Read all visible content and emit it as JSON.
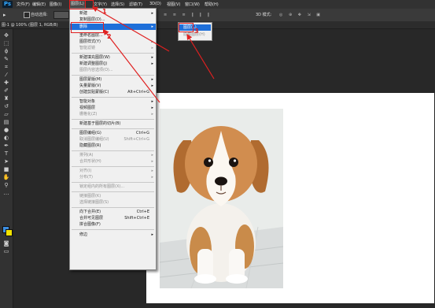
{
  "app": {
    "logo": "Ps"
  },
  "menubar": {
    "items": [
      {
        "label": "文件(F)"
      },
      {
        "label": "编辑(E)"
      },
      {
        "label": "图像(I)"
      },
      {
        "label": "图层(L)"
      },
      {
        "label": "文字(Y)"
      },
      {
        "label": "选择(S)"
      },
      {
        "label": "滤镜(T)"
      },
      {
        "label": "3D(D)"
      },
      {
        "label": "视图(V)"
      },
      {
        "label": "窗口(W)"
      },
      {
        "label": "帮助(H)"
      }
    ]
  },
  "options": {
    "auto_select": "自动选择:",
    "mode_3d": "3D 模式:"
  },
  "tab": {
    "title": "图-1 @ 100% (图层 1, RGB/8)"
  },
  "layer_menu": {
    "items": [
      {
        "label": "新建",
        "shortcut": "",
        "submenu": true,
        "disabled": false
      },
      {
        "label": "复制图层(D)...",
        "shortcut": "",
        "submenu": false,
        "disabled": false
      },
      {
        "label": "删除",
        "shortcut": "",
        "submenu": true,
        "disabled": false,
        "highlighted": true
      },
      {
        "label": "重命名图层...",
        "shortcut": "",
        "submenu": false,
        "disabled": false
      },
      {
        "label": "图层样式(Y)",
        "shortcut": "",
        "submenu": true,
        "disabled": false
      },
      {
        "label": "智能滤镜",
        "shortcut": "",
        "submenu": true,
        "disabled": true
      },
      {
        "label": "新建填充图层(W)",
        "shortcut": "",
        "submenu": true,
        "disabled": false
      },
      {
        "label": "新建调整图层(J)",
        "shortcut": "",
        "submenu": true,
        "disabled": false
      },
      {
        "label": "图层内容选项(O)...",
        "shortcut": "",
        "submenu": false,
        "disabled": true
      },
      {
        "label": "图层蒙版(M)",
        "shortcut": "",
        "submenu": true,
        "disabled": false
      },
      {
        "label": "矢量蒙版(V)",
        "shortcut": "",
        "submenu": true,
        "disabled": false
      },
      {
        "label": "创建剪贴蒙版(C)",
        "shortcut": "Alt+Ctrl+G",
        "submenu": false,
        "disabled": false
      },
      {
        "label": "智能对象",
        "shortcut": "",
        "submenu": true,
        "disabled": false
      },
      {
        "label": "视频图层",
        "shortcut": "",
        "submenu": true,
        "disabled": false
      },
      {
        "label": "栅格化(Z)",
        "shortcut": "",
        "submenu": true,
        "disabled": true
      },
      {
        "label": "新建基于图层的切片(B)",
        "shortcut": "",
        "submenu": false,
        "disabled": false
      },
      {
        "label": "图层编组(G)",
        "shortcut": "Ctrl+G",
        "submenu": false,
        "disabled": false
      },
      {
        "label": "取消图层编组(U)",
        "shortcut": "Shift+Ctrl+G",
        "submenu": false,
        "disabled": true
      },
      {
        "label": "隐藏图层(R)",
        "shortcut": "",
        "submenu": false,
        "disabled": false
      },
      {
        "label": "排列(A)",
        "shortcut": "",
        "submenu": true,
        "disabled": true
      },
      {
        "label": "合并形状(H)",
        "shortcut": "",
        "submenu": true,
        "disabled": true
      },
      {
        "label": "对齐(I)",
        "shortcut": "",
        "submenu": true,
        "disabled": true
      },
      {
        "label": "分布(T)",
        "shortcut": "",
        "submenu": true,
        "disabled": true
      },
      {
        "label": "锁定组内的所有图层(X)...",
        "shortcut": "",
        "submenu": false,
        "disabled": true
      },
      {
        "label": "链接图层(K)",
        "shortcut": "",
        "submenu": false,
        "disabled": true
      },
      {
        "label": "选择链接图层(S)",
        "shortcut": "",
        "submenu": false,
        "disabled": true
      },
      {
        "label": "向下合并(E)",
        "shortcut": "Ctrl+E",
        "submenu": false,
        "disabled": false
      },
      {
        "label": "合并可见图层",
        "shortcut": "Shift+Ctrl+E",
        "submenu": false,
        "disabled": false
      },
      {
        "label": "拼合图像(F)",
        "shortcut": "",
        "submenu": false,
        "disabled": false
      },
      {
        "label": "修边",
        "shortcut": "",
        "submenu": true,
        "disabled": false
      }
    ]
  },
  "delete_submenu": {
    "items": [
      {
        "label": "图层(L)"
      },
      {
        "label": "隐藏图层(H)"
      }
    ]
  },
  "annotations": {
    "step1": "1",
    "step2": "2",
    "step3": "3"
  },
  "colors": {
    "annotation": "#e02020",
    "highlight": "#1e6fd9"
  }
}
